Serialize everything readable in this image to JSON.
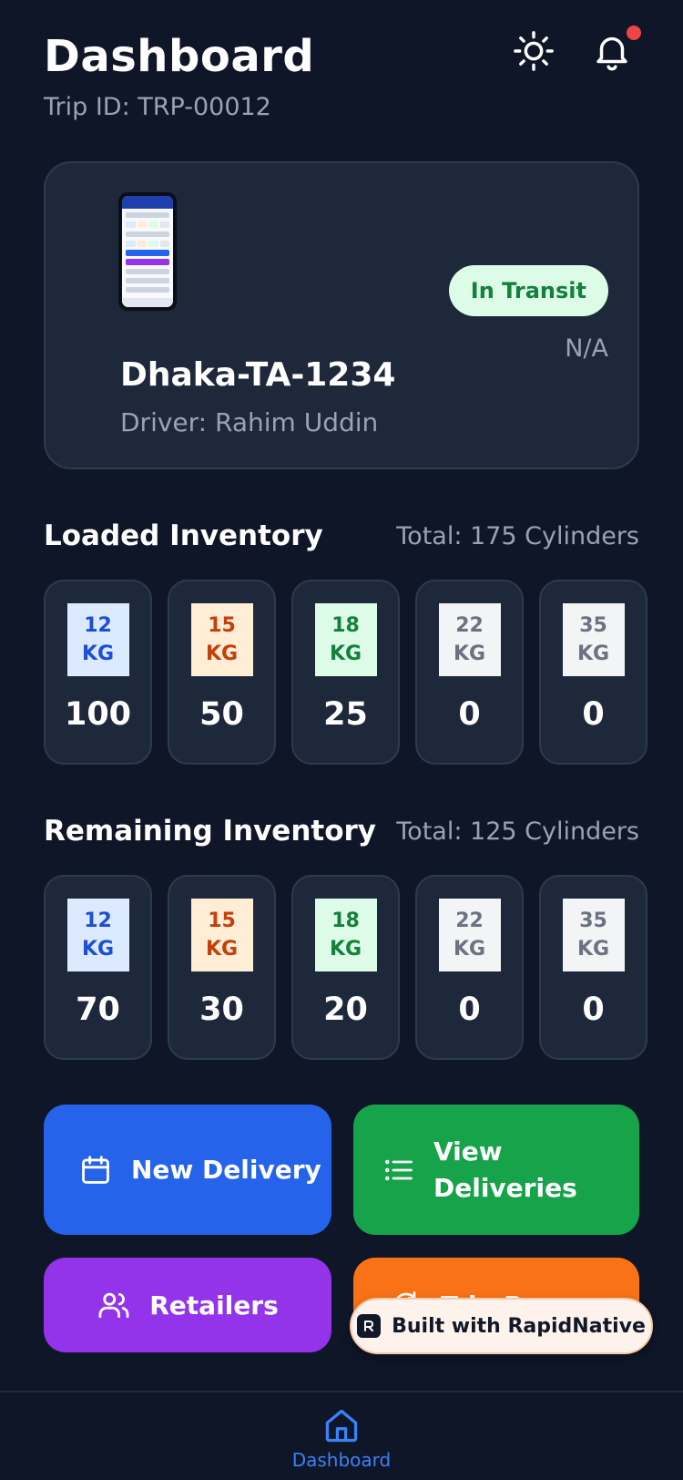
{
  "header": {
    "title": "Dashboard",
    "trip_id": "Trip ID: TRP-00012",
    "icons": [
      "sun-icon",
      "bell-icon"
    ]
  },
  "vehicle": {
    "plate": "Dhaka-TA-1234",
    "driver": "Driver: Rahim Uddin",
    "status": "In Transit",
    "eta": "N/A"
  },
  "loaded": {
    "title": "Loaded Inventory",
    "total": "Total: 175 Cylinders",
    "items": [
      {
        "num": "12",
        "unit": "KG",
        "count": "100"
      },
      {
        "num": "15",
        "unit": "KG",
        "count": "50"
      },
      {
        "num": "18",
        "unit": "KG",
        "count": "25"
      },
      {
        "num": "22",
        "unit": "KG",
        "count": "0"
      },
      {
        "num": "35",
        "unit": "KG",
        "count": "0"
      }
    ]
  },
  "remaining": {
    "title": "Remaining Inventory",
    "total": "Total: 125 Cylinders",
    "items": [
      {
        "num": "12",
        "unit": "KG",
        "count": "70"
      },
      {
        "num": "15",
        "unit": "KG",
        "count": "30"
      },
      {
        "num": "18",
        "unit": "KG",
        "count": "20"
      },
      {
        "num": "22",
        "unit": "KG",
        "count": "0"
      },
      {
        "num": "35",
        "unit": "KG",
        "count": "0"
      }
    ]
  },
  "actions": {
    "new_delivery": "New Delivery",
    "view_deliveries_1": "View",
    "view_deliveries_2": "Deliveries",
    "retailers": "Retailers",
    "trip_partial": "Trip R"
  },
  "badge": {
    "text": "Built with RapidNative"
  },
  "nav": {
    "dashboard": "Dashboard"
  },
  "colors": {
    "background": "#0f1628",
    "card": "#1e283b",
    "blue": "#2563eb",
    "green": "#16a34a",
    "purple": "#9333ea",
    "orange": "#f97316",
    "status_bg": "#dcfce7",
    "status_text": "#15803d",
    "chip_12_bg": "#dbeafe",
    "chip_12_text": "#1d4ed8",
    "chip_15_bg": "#ffedd5",
    "chip_15_text": "#c2410c",
    "chip_18_bg": "#dcfce7",
    "chip_18_text": "#15803d",
    "chip_22_bg": "#f3f4f6",
    "chip_22_text": "#6b7280",
    "chip_35_bg": "#f3f4f6",
    "chip_35_text": "#6b7280"
  }
}
